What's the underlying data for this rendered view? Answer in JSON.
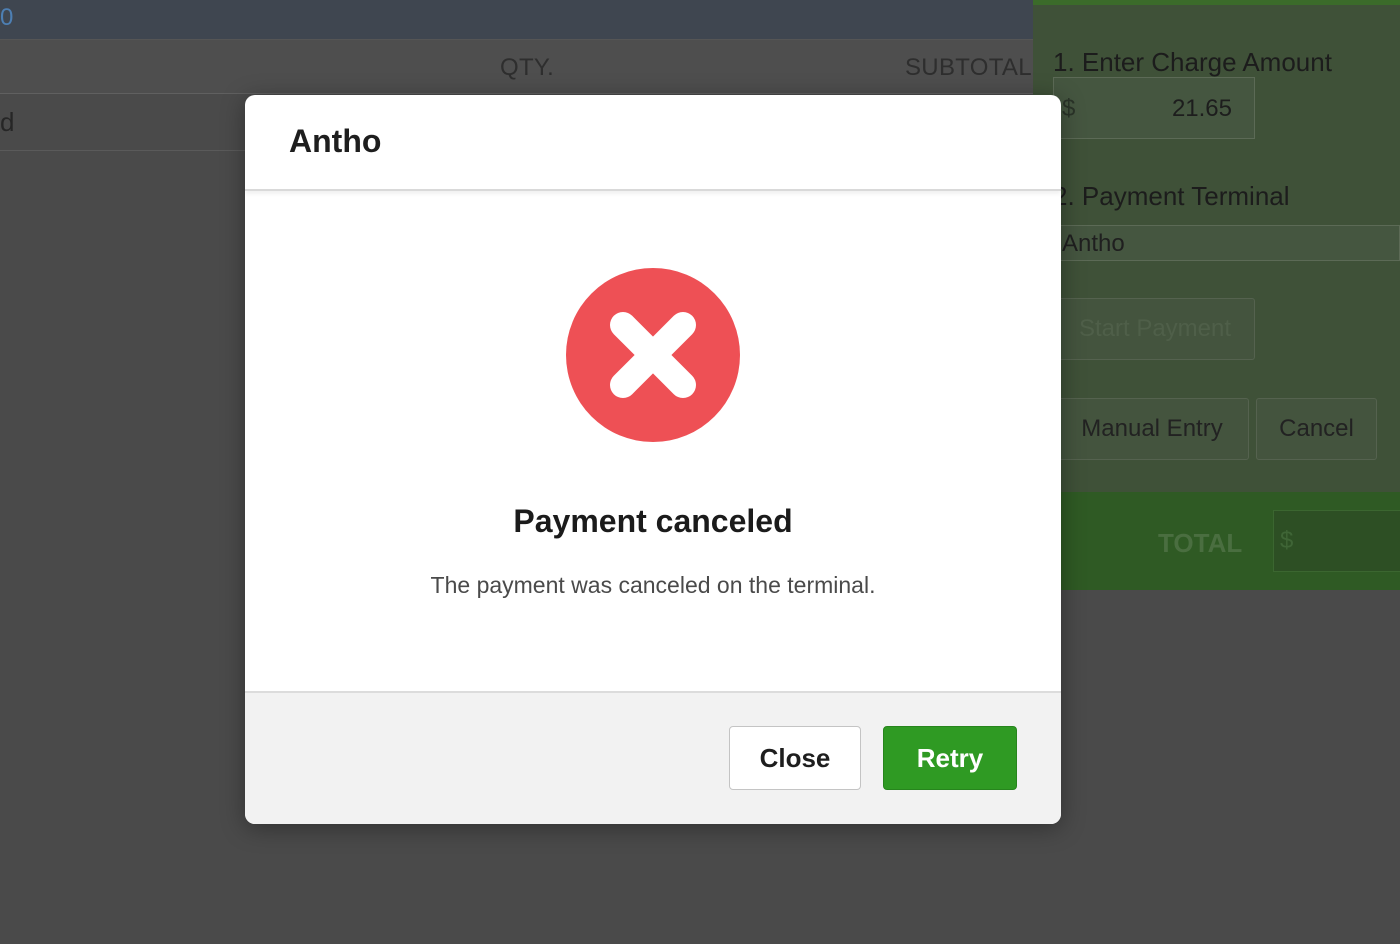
{
  "background": {
    "topbar_link": "0",
    "table": {
      "columns": {
        "qty": "QTY.",
        "subtotal": "SUBTOTAL"
      },
      "row_text": "d"
    },
    "payment_panel": {
      "step1_label": "1. Enter Charge Amount",
      "currency_symbol": "$",
      "charge_amount": "21.65",
      "step2_label": "2. Payment Terminal",
      "terminal_value": "Antho",
      "start_payment_label": "Start Payment",
      "manual_entry_label": "Manual Entry",
      "cancel_label": "Cancel",
      "total_label": "TOTAL",
      "total_currency": "$"
    }
  },
  "modal": {
    "title": "Antho",
    "status_icon": "error-x-circle-icon",
    "status_title": "Payment canceled",
    "status_message": "The payment was canceled on the terminal.",
    "close_label": "Close",
    "retry_label": "Retry"
  },
  "colors": {
    "error_red": "#ee5055",
    "retry_green": "#2f9a23",
    "overlay": "#4a4a4a"
  }
}
